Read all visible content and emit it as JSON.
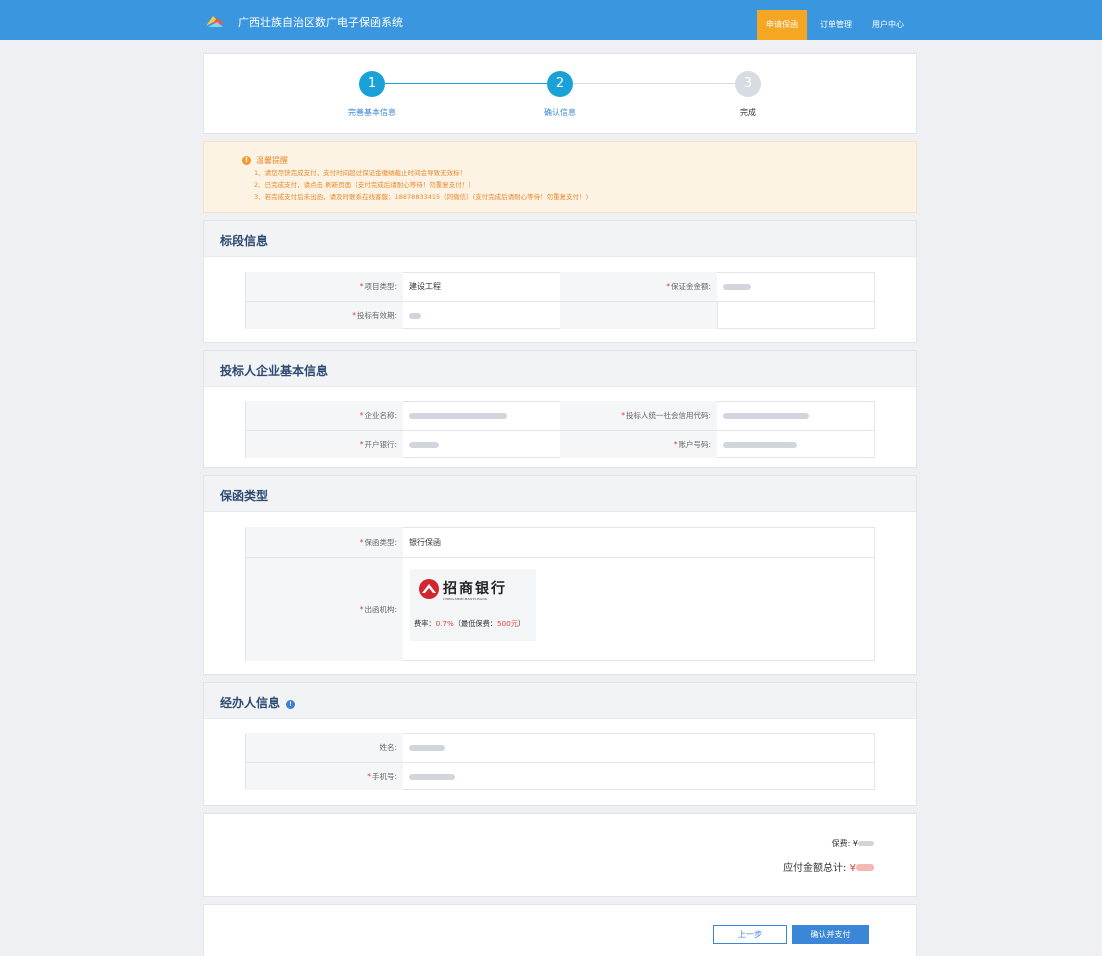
{
  "header": {
    "title": "广西壮族自治区数广电子保函系统",
    "nav": [
      "申请保函",
      "订单管理",
      "用户中心"
    ],
    "active_nav": "申请保函"
  },
  "steps": [
    {
      "number": "1",
      "label": "完善基本信息",
      "state": "done"
    },
    {
      "number": "2",
      "label": "确认信息",
      "state": "current"
    },
    {
      "number": "3",
      "label": "完成",
      "state": "todo"
    }
  ],
  "notice": {
    "title": "温馨提醒",
    "lines": [
      "1、请您尽快完成支付，支付时间超过保证金缴纳截止时间会导致无效标！",
      "2、已完成支付，请点击 刷新页面（支付完成后请耐心等待！勿重复支付！）",
      "3、若完成支付后未出函，请及时联系在线客服：18878833415（同微信）(支付完成后请耐心等待！勿重复支付！)"
    ]
  },
  "section_bid": {
    "title": "标段信息",
    "project_type_label": "项目类型:",
    "project_type_value": "建设工程",
    "deposit_label": "保证金金额:",
    "valid_label": "投标有效期:"
  },
  "section_company": {
    "title": "投标人企业基本信息",
    "company_label": "企业名称:",
    "credit_code_label": "投标人统一社会信用代码:",
    "bank_label": "开户银行:",
    "account_label": "账户号码:"
  },
  "section_guarantee": {
    "title": "保函类型",
    "type_label": "保函类型:",
    "type_value": "银行保函",
    "issuer_label": "出函机构:",
    "bank_name_cn": "招商银行",
    "bank_name_en": "CHINA MERCHANTS BANK",
    "rate_prefix": "费率：",
    "rate_value": "0.7%",
    "rate_mid": "（最低保费：",
    "min_fee": "500元",
    "rate_suffix": "）"
  },
  "section_operator": {
    "title": "经办人信息",
    "name_label": "姓名:",
    "phone_label": "手机号:"
  },
  "fees": {
    "premium_label": "保费:",
    "premium_currency": "¥",
    "total_label": "应付金额总计:",
    "total_currency": "¥"
  },
  "actions": {
    "prev_label": "上一步",
    "confirm_label": "确认并支付"
  },
  "colors": {
    "header_bg": "#3b96e0",
    "active_nav_bg": "#f5a623",
    "step_active": "#1aa2d8",
    "step_inactive": "#d7dbe2",
    "required_mark": "#e0413a",
    "total_amount": "#e0413a",
    "primary_button": "#3b86d6"
  }
}
